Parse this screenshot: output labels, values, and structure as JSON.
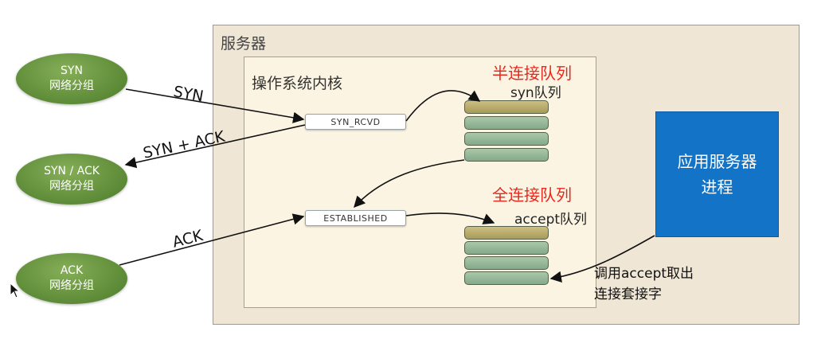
{
  "server": {
    "label": "服务器"
  },
  "kernel": {
    "label": "操作系统内核"
  },
  "half_queue": {
    "title": "半连接队列",
    "subtitle": "syn队列"
  },
  "full_queue": {
    "title": "全连接队列",
    "subtitle": "accept队列"
  },
  "states": {
    "syn_rcvd": "SYN_RCVD",
    "established": "ESTABLISHED"
  },
  "packets": [
    {
      "line1": "SYN",
      "line2": "网络分组"
    },
    {
      "line1": "SYN / ACK",
      "line2": "网络分组"
    },
    {
      "line1": "ACK",
      "line2": "网络分组"
    }
  ],
  "arrow_labels": {
    "syn": "SYN",
    "syn_ack": "SYN + ACK",
    "ack": "ACK"
  },
  "app": {
    "line1": "应用服务器",
    "line2": "进程"
  },
  "accept_note": {
    "line1": "调用accept取出",
    "line2": "连接套接字"
  },
  "colors": {
    "server_bg": "#efe6d6",
    "kernel_bg": "#fbf4e3",
    "queue_title": "#e8271d",
    "app_bg": "#1273c7",
    "packet_green": "#5c8a36"
  }
}
